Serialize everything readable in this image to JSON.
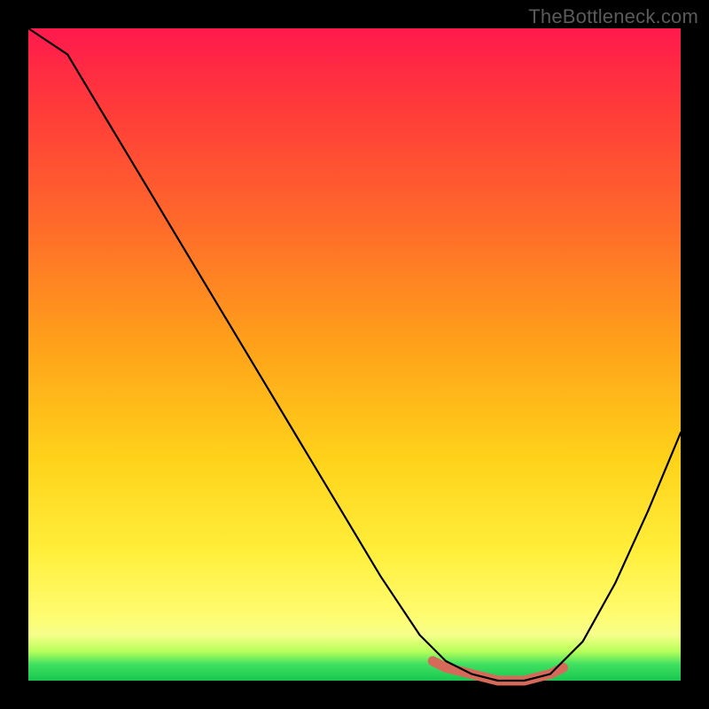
{
  "watermark": "TheBottleneck.com",
  "chart_data": {
    "type": "line",
    "title": "",
    "xlabel": "",
    "ylabel": "",
    "xlim": [
      0,
      100
    ],
    "ylim": [
      0,
      100
    ],
    "grid": false,
    "series": [
      {
        "name": "bottleneck-curve",
        "x": [
          0,
          6,
          12,
          18,
          24,
          30,
          36,
          42,
          48,
          54,
          60,
          64,
          68,
          72,
          76,
          80,
          85,
          90,
          95,
          100
        ],
        "values": [
          100,
          96,
          86,
          76,
          66,
          56,
          46,
          36,
          26,
          16,
          7,
          3,
          1,
          0,
          0,
          1,
          6,
          15,
          26,
          38
        ]
      },
      {
        "name": "optimal-valley-highlight",
        "x": [
          62,
          64,
          68,
          72,
          76,
          80,
          82
        ],
        "values": [
          3,
          2,
          1,
          0,
          0,
          1,
          2
        ]
      }
    ],
    "annotations": [],
    "colors": {
      "gradient_top": "#ff1a4d",
      "gradient_mid": "#ffd21a",
      "gradient_bottom": "#18c850",
      "curve": "#000000",
      "valley_highlight": "#d66a5a"
    }
  }
}
